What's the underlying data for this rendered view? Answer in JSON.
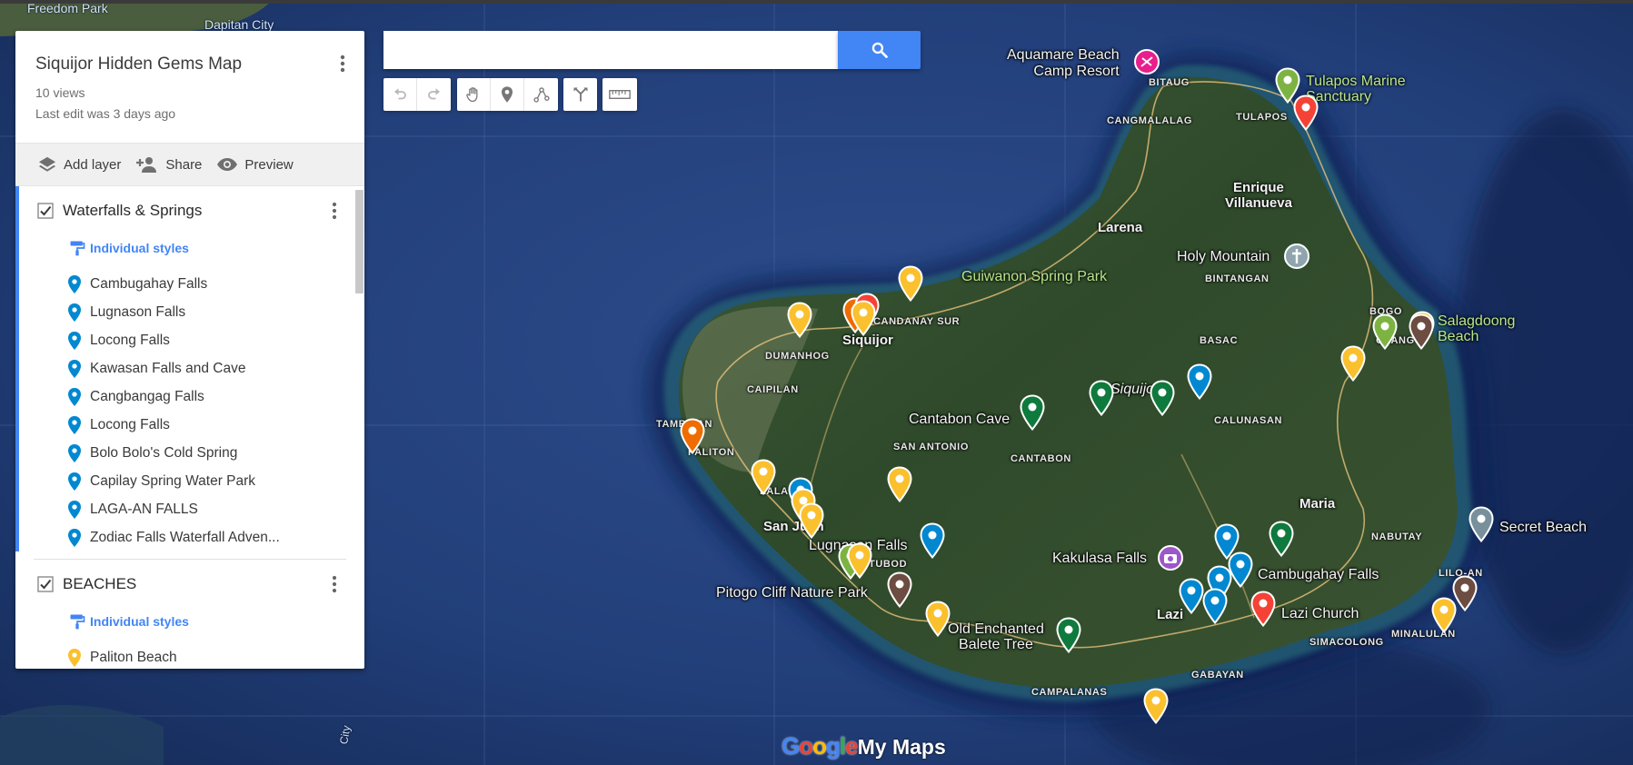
{
  "map_title": "Siquijor Hidden Gems Map",
  "views": "10 views",
  "last_edit": "Last edit was 3 days ago",
  "actions": {
    "add_layer": "Add layer",
    "share": "Share",
    "preview": "Preview"
  },
  "search": {
    "value": "",
    "placeholder": ""
  },
  "layers": [
    {
      "name": "Waterfalls & Springs",
      "style": "Individual styles",
      "items": [
        "Cambugahay Falls",
        "Lugnason Falls",
        "Locong Falls",
        "Kawasan Falls and Cave",
        "Cangbangag Falls",
        "Locong Falls",
        "Bolo Bolo's Cold Spring",
        "Capilay Spring Water Park",
        "LAGA-AN FALLS",
        "Zodiac Falls Waterfall Adven..."
      ],
      "icon_color": "#0288d1"
    },
    {
      "name": "BEACHES",
      "style": "Individual styles",
      "items": [
        "Paliton Beach"
      ],
      "icon_color": "#fbc02d"
    }
  ],
  "map_labels": {
    "freedom_park": "Freedom Park",
    "dapitan": "Dapitan City",
    "city_bottom": "City",
    "aquamare": "Aquamare Beach\nCamp Resort",
    "bitaug": "BITAUG",
    "cangmalalag": "CANGMALALAG",
    "tulapos": "TULAPOS",
    "tulapos_sanctuary": "Tulapos Marine\nSanctuary",
    "enrique": "Enrique\nVillanueva",
    "larena": "Larena",
    "holy_mountain": "Holy Mountain",
    "bintangan": "BINTANGAN",
    "guiwanon": "Guiwanon Spring Park",
    "candanay": "CANDANAY SUR",
    "siquijor_town": "Siquijor",
    "dumanhog": "DUMANHOG",
    "bogo": "BOGO",
    "olang": "OLANG",
    "salagdoong": "Salagdoong\nBeach",
    "basac": "BASAC",
    "caipilan": "CAIPILAN",
    "siquijor_island": "Siquijor",
    "calunasan": "CALUNASAN",
    "tambisan": "TAMBISAN",
    "paliton": "PALITON",
    "cantabon_cave": "Cantabon Cave",
    "san_antonio": "SAN ANTONIO",
    "cantabon": "CANTABON",
    "lala_o": "LALA-O",
    "san_juan": "San Juan",
    "lugnason_falls": "Lugnason Falls",
    "tubod": "TUBOD",
    "maria": "Maria",
    "nabutay": "NABUTAY",
    "secret_beach": "Secret Beach",
    "kakulasa": "Kakulasa Falls",
    "cambugahay": "Cambugahay Falls",
    "lilo_an": "LILO-AN",
    "pitogo": "Pitogo Cliff Nature Park",
    "lazi": "Lazi",
    "lazi_church": "Lazi Church",
    "minalulan": "MINALULAN",
    "simacolong": "SIMACOLONG",
    "old_balete": "Old Enchanted\nBalete Tree",
    "gabayan": "GABAYAN",
    "campalanas": "CAMPALANAS"
  },
  "watermark": {
    "g1": "G",
    "o1": "o",
    "o2": "o",
    "g2": "g",
    "l": "l",
    "e": "e",
    "mymaps": "My Maps"
  },
  "pin_colors": {
    "yellow": "#fbc02d",
    "blue": "#0288d1",
    "green_dark": "#0f7a3d",
    "green_light": "#7cb342",
    "red": "#f44336",
    "orange": "#ef6c00",
    "brown": "#6d4c41",
    "pink": "#e91e8c",
    "purple": "#9c57c8",
    "gray": "#78909c"
  },
  "icons": {
    "search": "search-icon",
    "undo": "undo-icon",
    "redo": "redo-icon",
    "hand": "hand-icon",
    "marker": "marker-icon",
    "line": "draw-line-icon",
    "directions": "directions-icon",
    "ruler": "ruler-icon"
  }
}
